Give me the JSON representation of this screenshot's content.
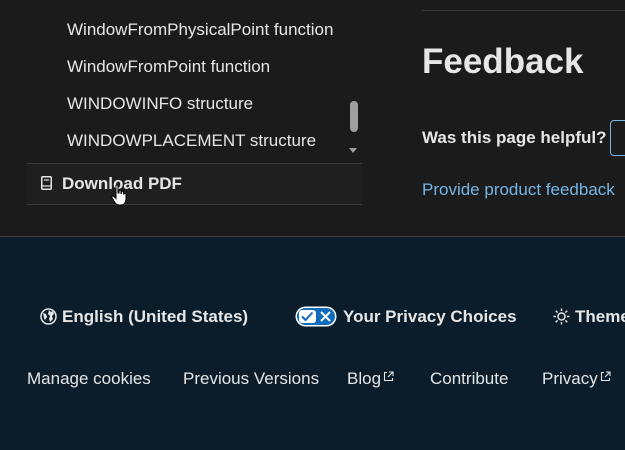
{
  "toc": {
    "items": [
      "WindowFromPhysicalPoint function",
      "WindowFromPoint function",
      "WINDOWINFO structure",
      "WINDOWPLACEMENT structure"
    ],
    "download_pdf": "Download PDF"
  },
  "feedback": {
    "title": "Feedback",
    "question": "Was this page helpful?",
    "product_feedback_link": "Provide product feedback"
  },
  "footer": {
    "language": "English (United States)",
    "privacy_choices": "Your Privacy Choices",
    "theme": "Theme",
    "links": {
      "manage_cookies": "Manage cookies",
      "previous_versions": "Previous Versions",
      "blog": "Blog",
      "contribute": "Contribute",
      "privacy": "Privacy"
    }
  },
  "colors": {
    "page_bg": "#1b1b1b",
    "footer_bg": "#0b1d2b",
    "link": "#75b6e7",
    "toggle_accent": "#0f6cbd"
  },
  "icons": {
    "pdf": "book-icon",
    "language": "globe-icon",
    "privacy": "privacy-toggle-icon",
    "theme": "sun-icon",
    "external": "external-link-icon",
    "cursor": "hand-pointer-icon"
  }
}
